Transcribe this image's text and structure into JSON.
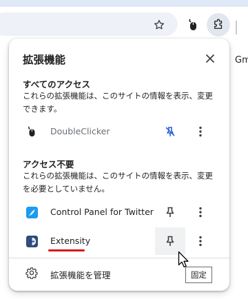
{
  "toolbar": {
    "star_icon": "bookmark-star-icon",
    "extension_icon": "doubleclicker-mouse-icon",
    "puzzle_icon": "extensions-puzzle-icon",
    "page_text_fragment": "Gm"
  },
  "popup": {
    "title": "拡張機能",
    "close_icon": "close-icon",
    "sections": [
      {
        "heading": "すべてのアクセス",
        "description": "これらの拡張機能は、このサイトの情報を表示、変更できます。",
        "extensions": [
          {
            "name": "DoubleClicker",
            "icon": "mouse-icon",
            "pinned": true,
            "muted": true,
            "accent": "#2b63d9"
          }
        ]
      },
      {
        "heading": "アクセス不要",
        "description": "これらの拡張機能は、このサイトの情報を表示、変更を必要としていません。",
        "extensions": [
          {
            "name": "Control Panel for Twitter",
            "icon": "control-panel-bird-icon",
            "pinned": false
          },
          {
            "name": "Extensity",
            "icon": "extensity-icon",
            "pinned": false,
            "hovered": true
          }
        ]
      }
    ],
    "manage_label": "拡張機能を管理",
    "manage_icon": "gear-icon"
  },
  "tooltip": {
    "text": "固定"
  },
  "colors": {
    "accent_blue": "#2b63d9",
    "underline_red": "#d8151c",
    "toolbar_blue": "#dfe8f6"
  }
}
